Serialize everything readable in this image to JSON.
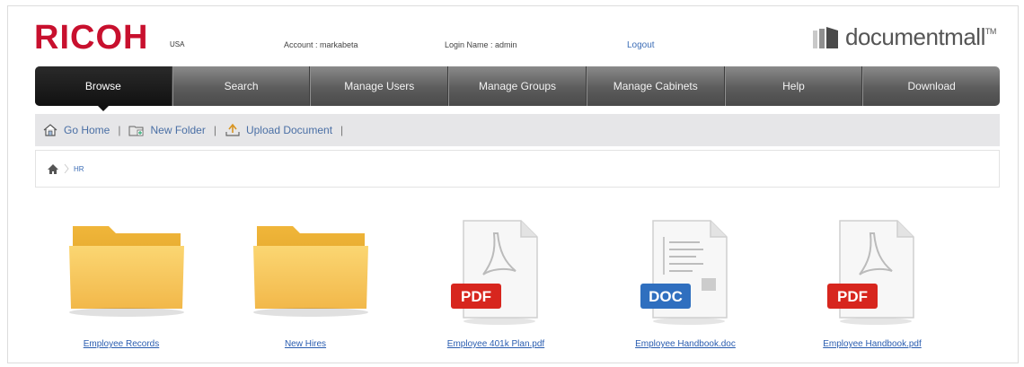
{
  "header": {
    "brand": "RICOH",
    "brand_region": "USA",
    "account": "Account : markabeta",
    "login_name": "Login Name : admin",
    "logout": "Logout",
    "product_logo": "documentmall",
    "product_tm": "TM"
  },
  "nav": {
    "items": [
      {
        "label": "Browse",
        "active": true
      },
      {
        "label": "Search"
      },
      {
        "label": "Manage Users"
      },
      {
        "label": "Manage Groups"
      },
      {
        "label": "Manage Cabinets"
      },
      {
        "label": "Help"
      },
      {
        "label": "Download"
      }
    ]
  },
  "toolbar": {
    "go_home": "Go Home",
    "new_folder": "New Folder",
    "upload_document": "Upload Document",
    "separator": "|"
  },
  "breadcrumb": {
    "current": "HR"
  },
  "items": [
    {
      "type": "folder",
      "name": "Employee Records"
    },
    {
      "type": "folder",
      "name": "New Hires"
    },
    {
      "type": "pdf",
      "name": "Employee 401k Plan.pdf",
      "badge": "PDF"
    },
    {
      "type": "doc",
      "name": "Employee Handbook.doc",
      "badge": "DOC"
    },
    {
      "type": "pdf",
      "name": "Employee Handbook.pdf",
      "badge": "PDF"
    }
  ],
  "colors": {
    "brand_red": "#c8102e",
    "link_blue": "#2a5db0",
    "nav_dark": "#111111",
    "pdf_red": "#d7261e",
    "doc_blue": "#2f6fbf",
    "folder_yellow": "#f5c24c"
  }
}
